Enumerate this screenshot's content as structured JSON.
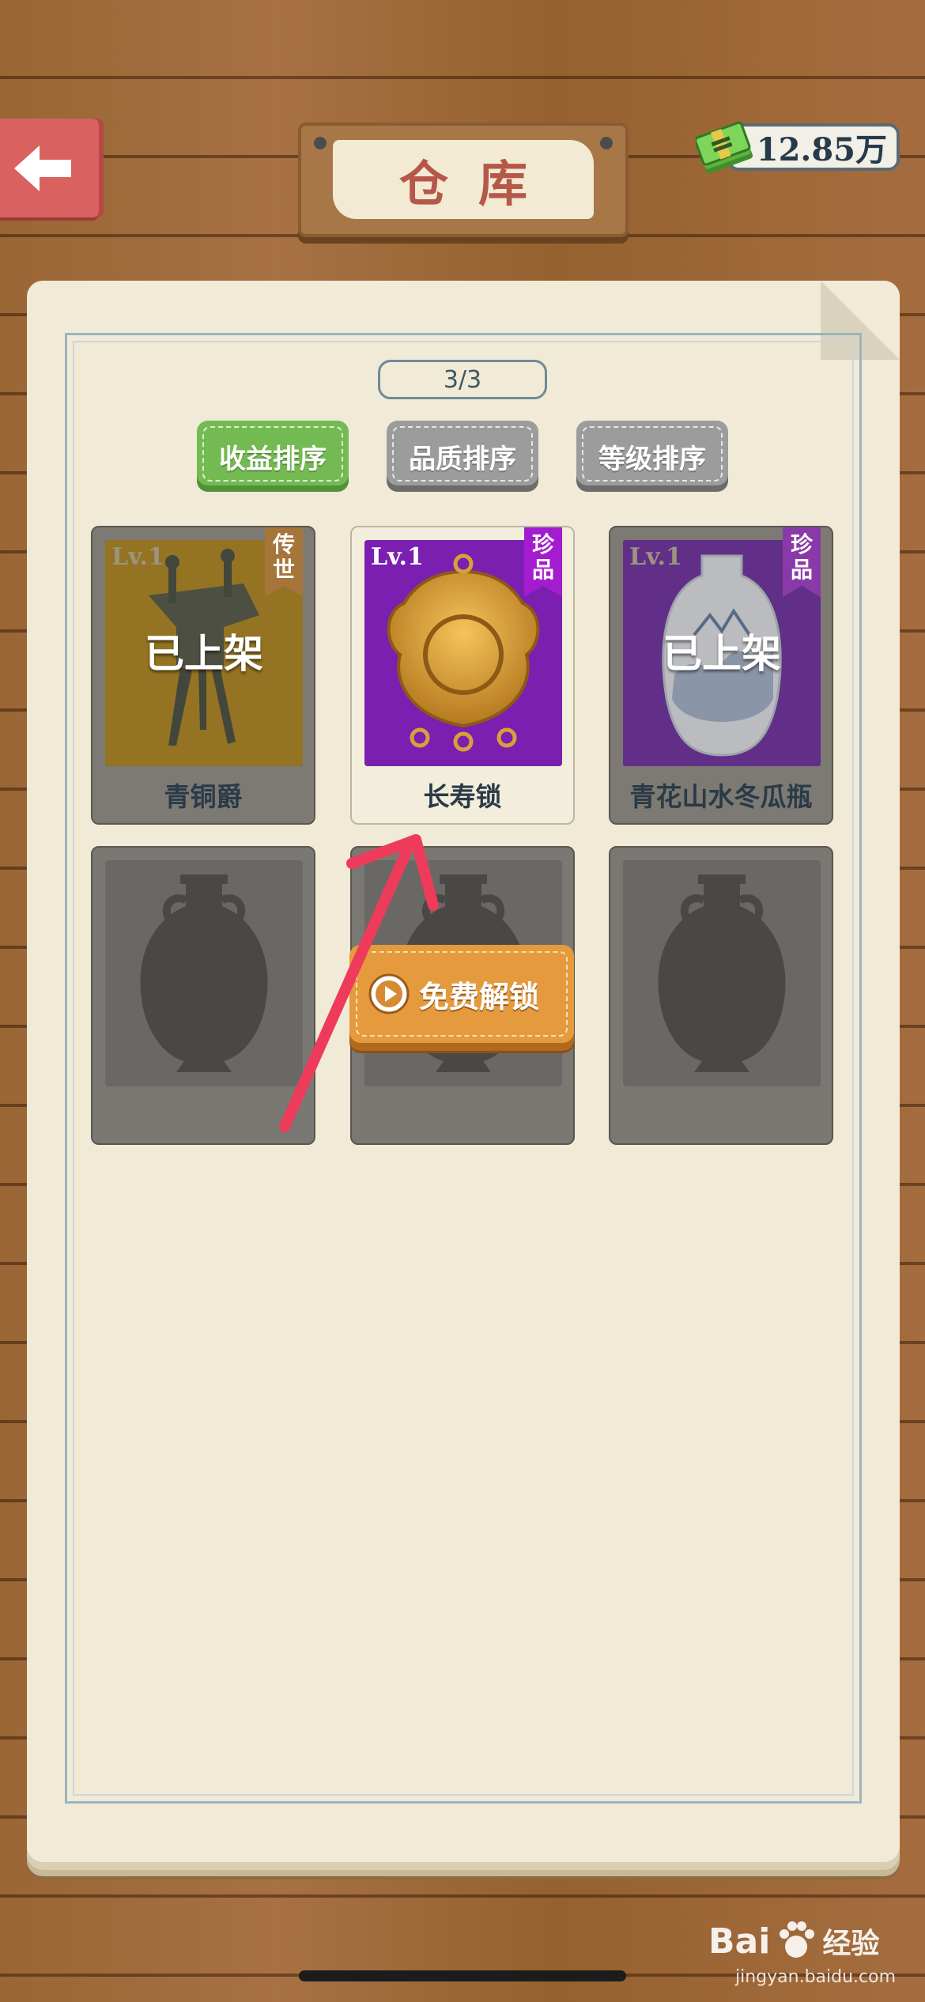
{
  "header": {
    "title": "仓库",
    "back_icon": "back-arrow-icon",
    "currency": {
      "icon": "cash-stack-icon",
      "amount": "12.85万"
    }
  },
  "page_indicator": "3/3",
  "sort_tabs": [
    {
      "label": "收益排序",
      "active": true
    },
    {
      "label": "品质排序",
      "active": false
    },
    {
      "label": "等级排序",
      "active": false
    }
  ],
  "items": [
    {
      "name": "青铜爵",
      "level": "Lv.1",
      "rarity": "传世",
      "rarity_color": "#a6753a",
      "status": "已上架",
      "art_color": "#b8860b"
    },
    {
      "name": "长寿锁",
      "level": "Lv.1",
      "rarity": "珍品",
      "rarity_color": "#a41ccf",
      "status": "",
      "art_color": "#7a1fb0"
    },
    {
      "name": "青花山水冬瓜瓶",
      "level": "Lv.1",
      "rarity": "珍品",
      "rarity_color": "#a41ccf",
      "status": "已上架",
      "art_color": "#6a1ea6"
    }
  ],
  "locked_slots": [
    {
      "icon": "vase-silhouette-icon"
    },
    {
      "icon": "vase-silhouette-icon"
    },
    {
      "icon": "vase-silhouette-icon"
    }
  ],
  "unlock_button": {
    "label": "免费解锁",
    "icon": "play-video-icon"
  },
  "annotation": {
    "icon": "red-pointer-arrow-icon",
    "color": "#ee3b5b"
  },
  "watermark": {
    "brand": "Bai",
    "brand2": "经验",
    "url": "jingyan.baidu.com"
  }
}
